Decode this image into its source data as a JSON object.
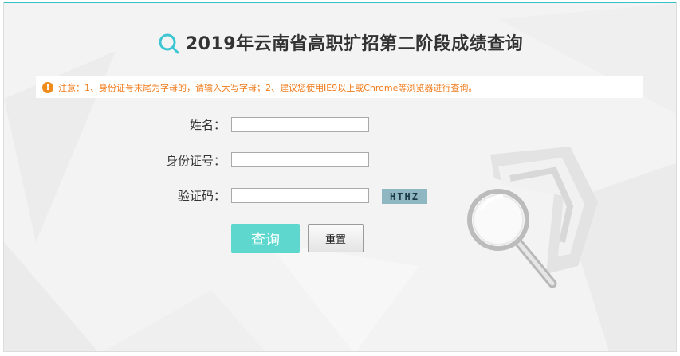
{
  "header": {
    "title": "2019年云南省高职扩招第二阶段成绩查询",
    "icon": "search-icon"
  },
  "notice": {
    "icon": "warning-icon",
    "text": "注意：1、身份证号末尾为字母的，请输入大写字母；2、建议您使用IE9以上或Chrome等浏览器进行查询。",
    "color": "#f07a19"
  },
  "form": {
    "name_label": "姓名：",
    "name_value": "",
    "id_label": "身份证号：",
    "id_value": "",
    "captcha_label": "验证码：",
    "captcha_value": "",
    "captcha_code": "HTHZ"
  },
  "buttons": {
    "query": "查询",
    "reset": "重置"
  },
  "colors": {
    "accent": "#2fc3c3",
    "query_button": "#5ed8cf",
    "captcha_bg": "#8fb7c2"
  }
}
